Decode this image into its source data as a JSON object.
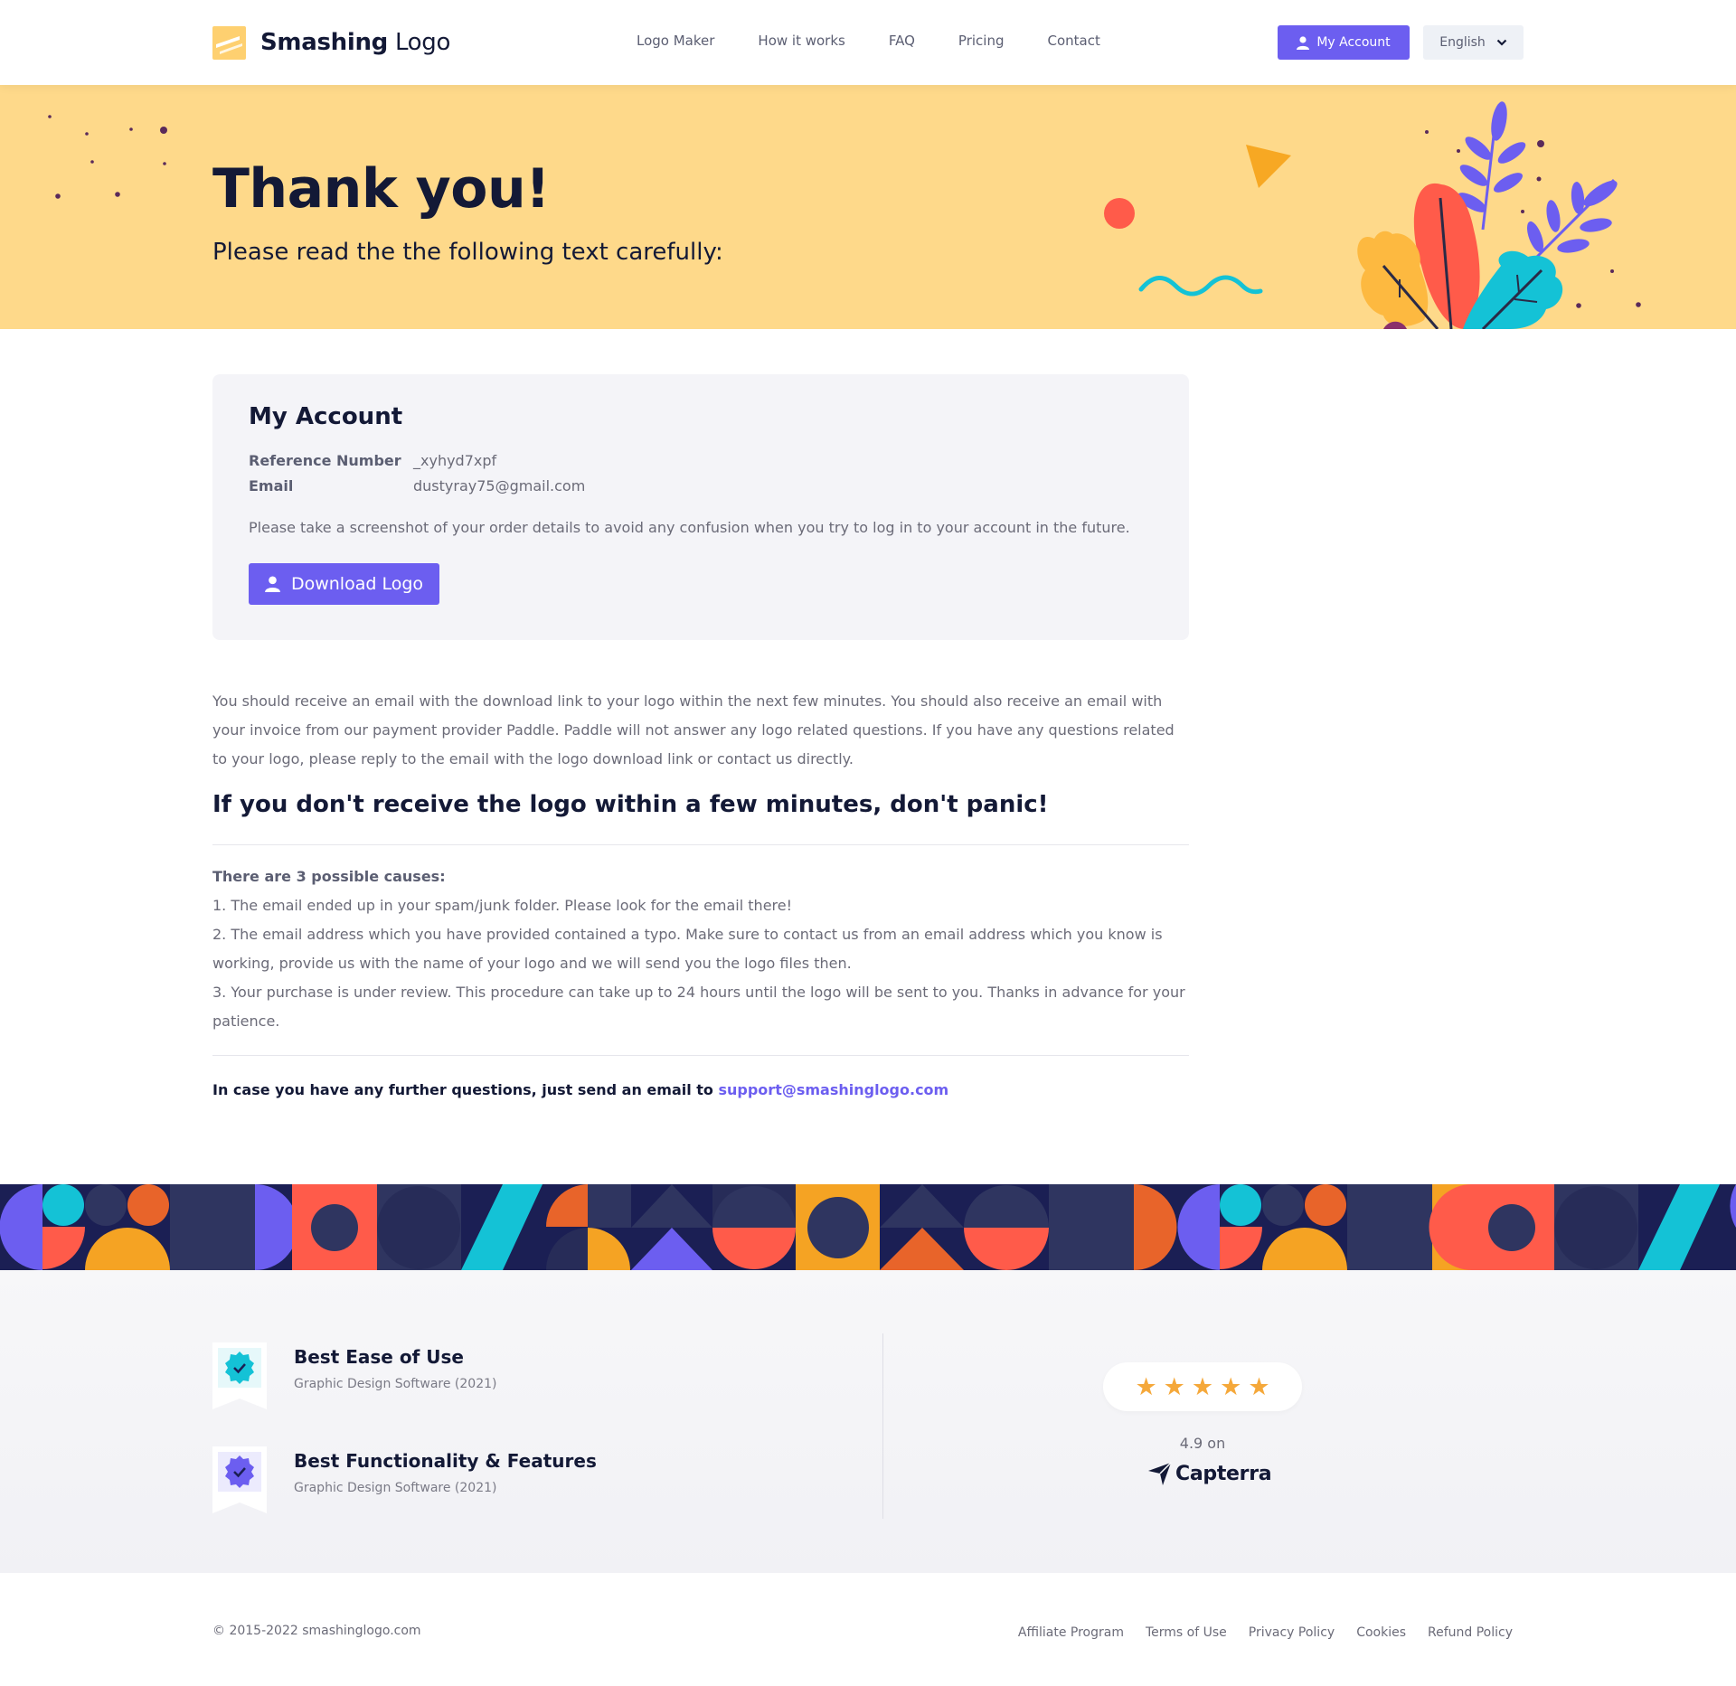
{
  "header": {
    "brand_bold": "Smashing",
    "brand_light": " Logo",
    "nav": [
      "Logo Maker",
      "How it works",
      "FAQ",
      "Pricing",
      "Contact"
    ],
    "account_label": "My Account",
    "language_label": "English"
  },
  "hero": {
    "title": "Thank you!",
    "subtitle": "Please read the the following text carefully:"
  },
  "account": {
    "title": "My Account",
    "reference_label": "Reference Number",
    "reference_value": "_xyhyd7xpf",
    "email_label": "Email",
    "email_value": "dustyray75@gmail.com",
    "note": "Please take a screenshot of your order details to avoid any confusion when you try to log in to your account in the future.",
    "download_label": "Download Logo"
  },
  "content": {
    "paragraph": "You should receive an email with the download link to your logo within the next few minutes. You should also receive an email with your invoice from our payment provider Paddle. Paddle will not answer any logo related questions. If you have any questions related to your logo, please reply to the email with the logo download link or contact us directly.",
    "heading": "If you don't receive the logo within a few minutes, don't panic!",
    "causes_lead": "There are 3 possible causes:",
    "causes": [
      "1. The email ended up in your spam/junk folder. Please look for the email there!",
      "2. The email address which you have provided contained a typo. Make sure to contact us from an email address which you know is working, provide us with the name of your logo and we will send you the logo files then.",
      "3. Your purchase is under review. This procedure can take up to 24 hours until the logo will be sent to you. Thanks in advance for your patience."
    ],
    "contact_text": "In case you have any further questions, just send an email to ",
    "contact_email": "support@smashinglogo.com"
  },
  "awards": [
    {
      "title": "Best Ease of Use",
      "subtitle": "Graphic Design Software (2021)",
      "icon": "check-badge-icon",
      "color": "#14c2d6"
    },
    {
      "title": "Best Functionality & Features",
      "subtitle": "Graphic Design Software (2021)",
      "icon": "check-badge-icon",
      "color": "#6c5ef0"
    }
  ],
  "rating": {
    "stars": 5,
    "star_glyph": "★",
    "text": "4.9 on",
    "brand": "Capterra"
  },
  "footer": {
    "copyright": "© 2015-2022 smashinglogo.com",
    "links": [
      "Affiliate Program",
      "Terms of Use",
      "Privacy Policy",
      "Cookies",
      "Refund Policy"
    ]
  },
  "colors": {
    "primary": "#6c5ef0",
    "hero_bg": "#fed98a",
    "navy": "#131936",
    "star": "#f5a83a"
  }
}
